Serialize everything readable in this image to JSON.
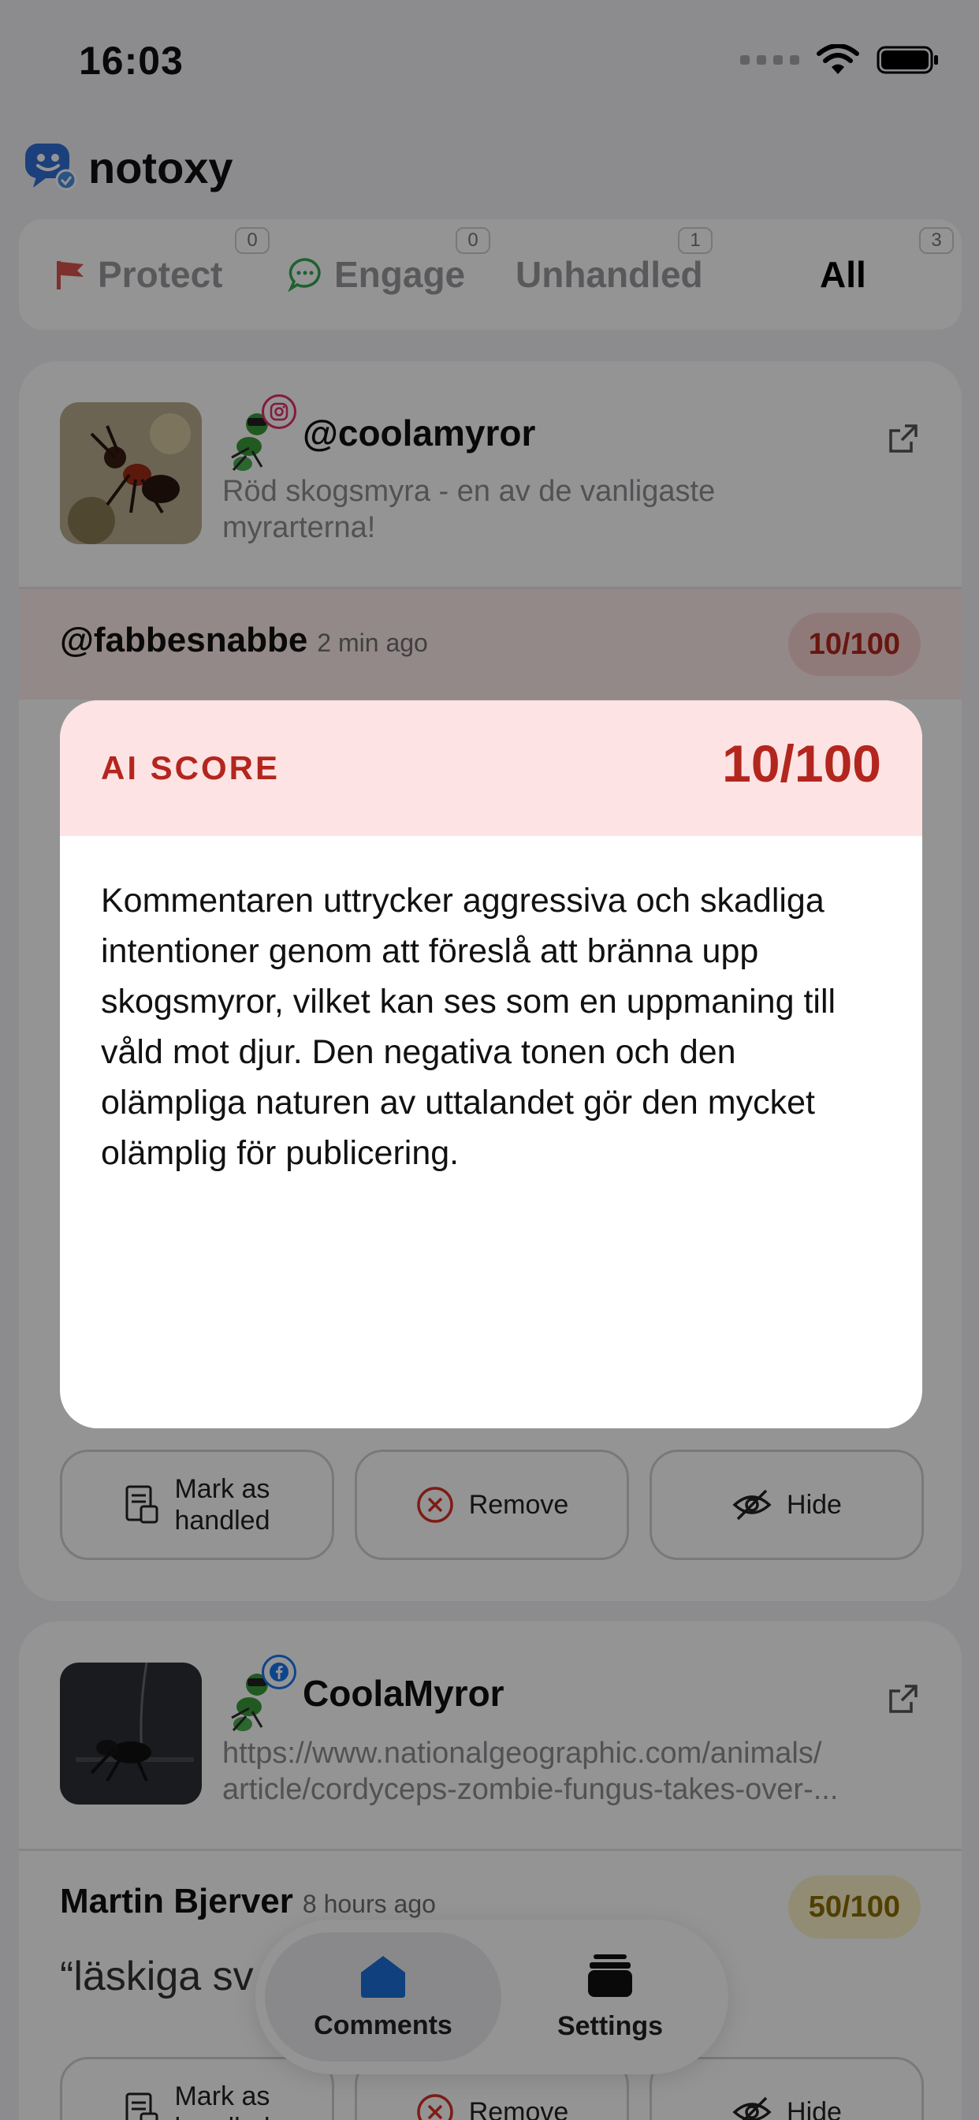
{
  "status_bar": {
    "time": "16:03"
  },
  "app": {
    "name": "notoxy"
  },
  "tabs": [
    {
      "label": "Protect",
      "count": "0",
      "icon": "flag-icon"
    },
    {
      "label": "Engage",
      "count": "0",
      "icon": "chat-bubble-icon"
    },
    {
      "label": "Unhandled",
      "count": "1"
    },
    {
      "label": "All",
      "count": "3",
      "active": true
    }
  ],
  "cards": [
    {
      "handle": "@coolamyror",
      "platform": "instagram",
      "caption": "Röd skogsmyra - en av de vanligaste myrarterna!",
      "comment": {
        "author": "@fabbesnabbe",
        "time": "2 min ago",
        "score": "10/100"
      },
      "actions": {
        "handled_line1": "Mark as",
        "handled_line2": "handled",
        "remove": "Remove",
        "hide": "Hide"
      }
    },
    {
      "handle": "CoolaMyror",
      "platform": "facebook",
      "caption_line1": "https://www.nationalgeographic.com/animals/",
      "caption_line2": "article/cordyceps-zombie-fungus-takes-over-...",
      "comment": {
        "author": "Martin Bjerver",
        "time": "8 hours ago",
        "score": "50/100",
        "text": "“läskiga sv"
      },
      "actions": {
        "handled_line1": "Mark as",
        "handled_line2": "handled",
        "remove": "Remove",
        "hide": "Hide"
      }
    }
  ],
  "tab_bar": {
    "comments": "Comments",
    "settings": "Settings"
  },
  "modal": {
    "title": "AI SCORE",
    "score": "10/100",
    "explanation": "Kommentaren uttrycker aggressiva och skadliga intentioner genom att föreslå att bränna upp skogsmyror, vilket kan ses som en uppmaning till våld mot djur. Den negativa tonen och den olämpliga naturen av uttalandet gör den mycket olämplig för publicering."
  },
  "colors": {
    "danger": "#b3261e",
    "danger_bg": "#fde3e3",
    "warning_bg": "#fbf1c8",
    "instagram": "#e1306c",
    "facebook": "#1877f2"
  }
}
